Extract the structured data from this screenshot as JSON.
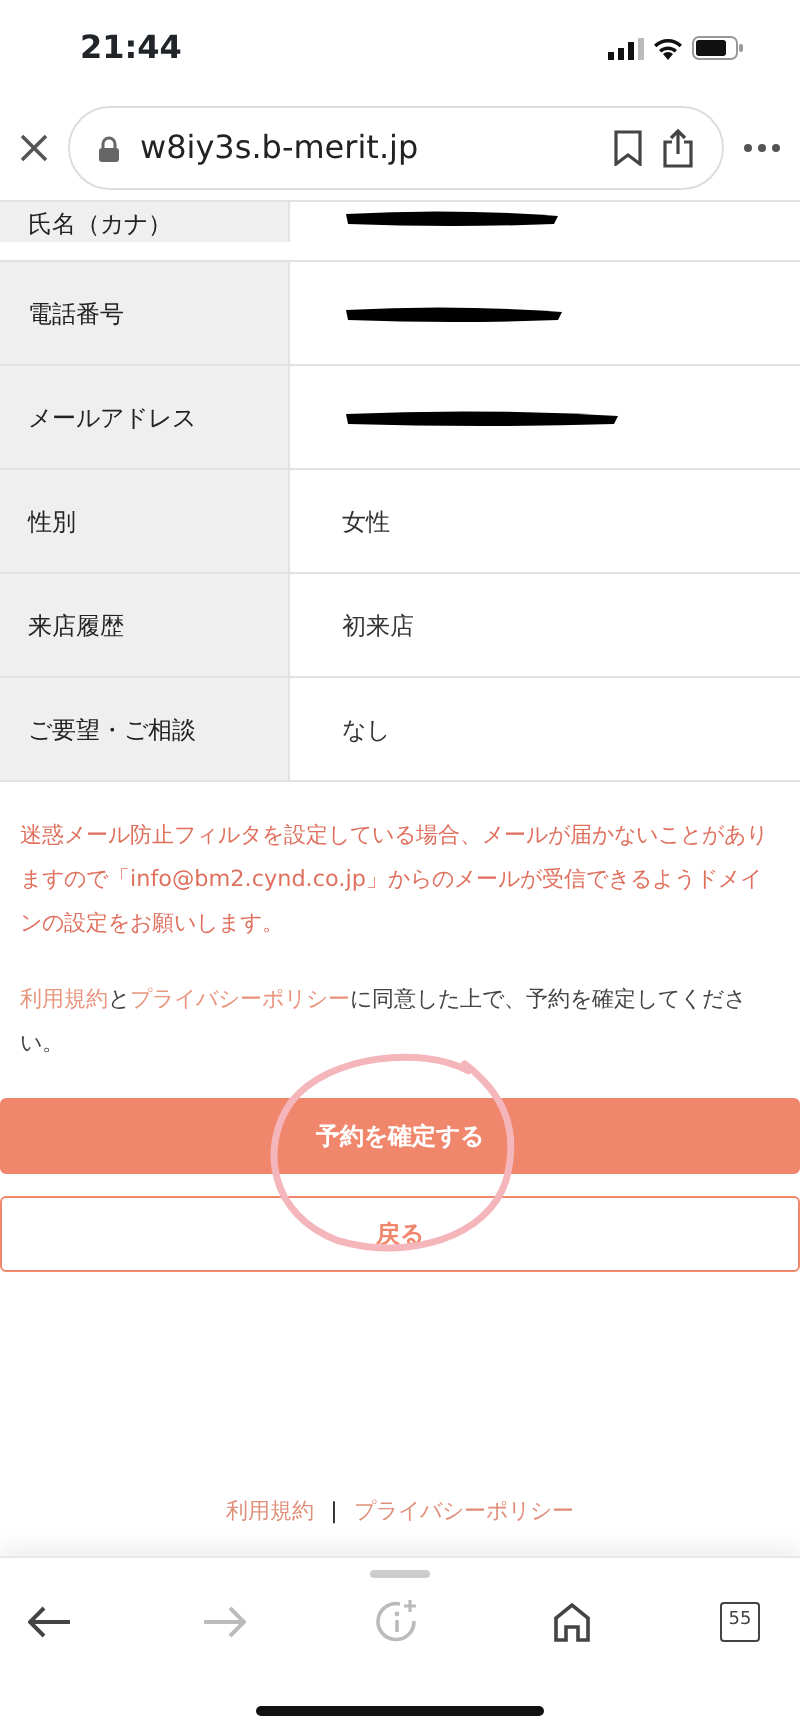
{
  "status_bar": {
    "time": "21:44"
  },
  "browser": {
    "url": "w8iy3s.b-merit.jp"
  },
  "table": {
    "rows": [
      {
        "label": "氏名（カナ）",
        "redacted": true
      },
      {
        "label": "電話番号",
        "redacted": true
      },
      {
        "label": "メールアドレス",
        "redacted": true
      },
      {
        "label": "性別",
        "value": "女性",
        "redacted": false
      },
      {
        "label": "来店履歴",
        "value": "初来店",
        "redacted": false
      },
      {
        "label": "ご要望・ご相談",
        "value": "なし",
        "redacted": false
      }
    ]
  },
  "notice": "迷惑メール防止フィルタを設定している場合、メールが届かないことがありますので「info@bm2.cynd.co.jp」からのメールが受信できるようドメインの設定をお願いします。",
  "agreement": [
    {
      "kind": "link",
      "text": "利用規約"
    },
    {
      "kind": "text",
      "text": "と"
    },
    {
      "kind": "link",
      "text": "プライバシーポリシー"
    },
    {
      "kind": "text",
      "text": "に同意した上で、予約を確定してください。"
    }
  ],
  "buttons": [
    {
      "kind": "primary",
      "label": "予約を確定する",
      "circled": true
    },
    {
      "kind": "outline",
      "label": "戻る",
      "circled": false
    }
  ],
  "footer_links": [
    "利用規約",
    "プライバシーポリシー"
  ],
  "footer_separator": "|",
  "toolbar": {
    "back_disabled": false,
    "forward_disabled": true,
    "tab_count": "55"
  }
}
